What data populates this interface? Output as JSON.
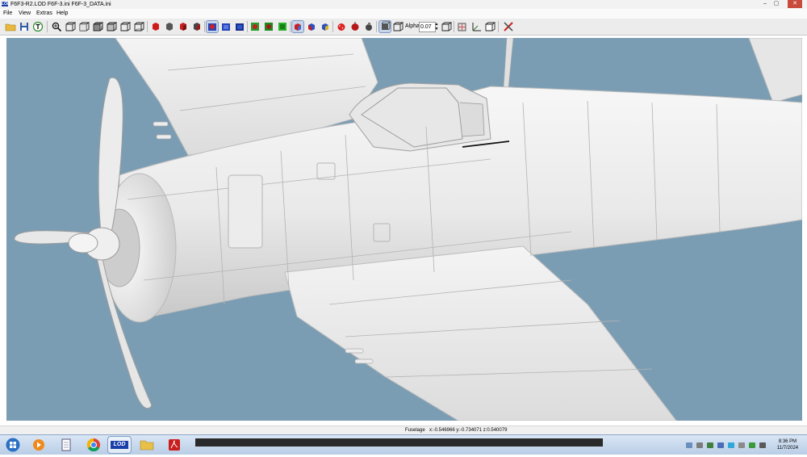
{
  "window": {
    "title": "F6F3-R2.LOD  F6F-3.ini  F6F-3_DATA.ini",
    "app_icon_text": "LOD",
    "controls": {
      "minimize": "–",
      "maximize": "▢",
      "close": "✕"
    }
  },
  "menu": {
    "items": [
      "File",
      "View",
      "Extras",
      "Help"
    ]
  },
  "toolbar": {
    "alpha_label": "Alpha:",
    "alpha_value": "0.07",
    "icons": {
      "open": "folder-icon",
      "save": "floppy-icon",
      "text": "text-tool-icon",
      "zoom": "zoom-icon",
      "cube": "cube-icon",
      "paint": "paint-icon",
      "light": "light-icon",
      "alpha": "alpha-icon",
      "axis": "axis-icon",
      "settings": "tools-icon"
    }
  },
  "status": {
    "object": "Fuselage",
    "coords": "x:-0.546966 y:-0.734071 z:0.540079"
  },
  "taskbar": {
    "apps": [
      "start",
      "media-player",
      "document",
      "chrome",
      "lod-viewer",
      "file-explorer",
      "acrobat"
    ],
    "lod_label": "LOD",
    "clock_time": "8:36 PM",
    "clock_date": "11/7/2024"
  },
  "colors": {
    "viewport_bg": "#7b9db3",
    "model": "#f2f2f2",
    "accent": "#1a3fa8"
  }
}
